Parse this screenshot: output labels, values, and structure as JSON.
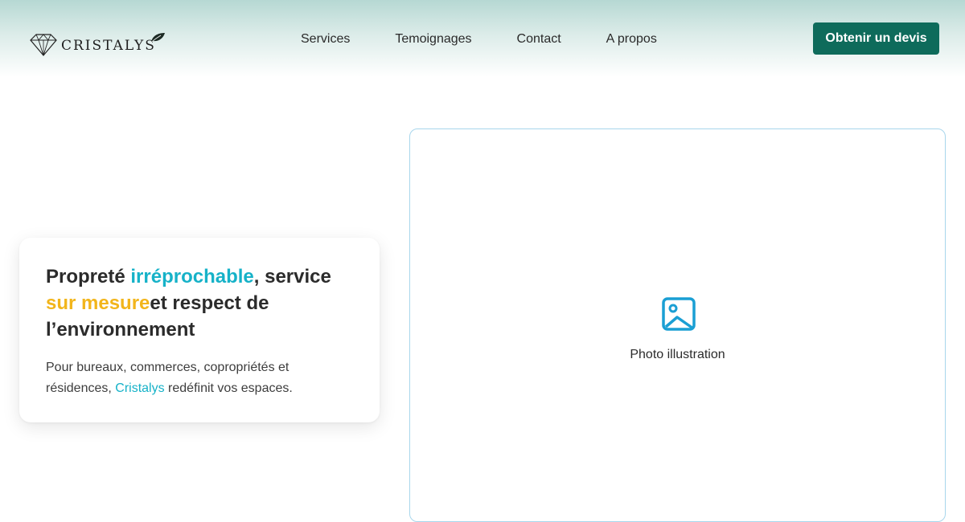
{
  "brand": {
    "name": "CRISTALYS"
  },
  "nav": {
    "items": [
      {
        "label": "Services"
      },
      {
        "label": "Temoignages"
      },
      {
        "label": "Contact"
      },
      {
        "label": "A propos"
      }
    ],
    "cta_label": "Obtenir un devis"
  },
  "hero": {
    "title_part1": "Propreté ",
    "title_accent1": "irréprochable",
    "title_part2": ", service ",
    "title_accent2": "sur mesure",
    "title_part3": "et respect de l’environnement",
    "subtitle_part1": "Pour bureaux, commerces, copropriétés et résidences, ",
    "subtitle_link": "Cristalys",
    "subtitle_part2": " redéfinit vos espaces."
  },
  "media": {
    "caption": "Photo illustration",
    "icon": "image-icon"
  },
  "colors": {
    "brand_green": "#0e6b5b",
    "accent_cyan": "#16b2c8",
    "accent_yellow": "#f2b51b",
    "border_blue": "#a8d6ec"
  }
}
